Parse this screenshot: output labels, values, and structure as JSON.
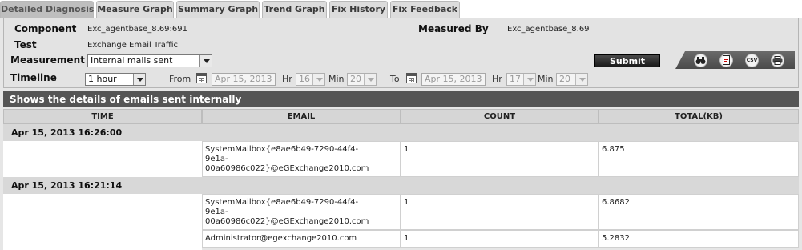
{
  "tabs": [
    {
      "label": "Detailed Diagnosis",
      "active": true
    },
    {
      "label": "Measure Graph"
    },
    {
      "label": "Summary Graph"
    },
    {
      "label": "Trend Graph"
    },
    {
      "label": "Fix History"
    },
    {
      "label": "Fix Feedback"
    }
  ],
  "header": {
    "component_label": "Component",
    "component_value": "Exc_agentbase_8.69:691",
    "test_label": "Test",
    "test_value": "Exchange Email Traffic",
    "measured_by_label": "Measured By",
    "measured_by_value": "Exc_agentbase_8.69",
    "measurement_label": "Measurement",
    "measurement_value": "Internal mails sent",
    "timeline_label": "Timeline",
    "timeline_value": "1 hour",
    "from_label": "From",
    "from_date": "Apr 15, 2013",
    "from_hr_label": "Hr",
    "from_hr": "16",
    "from_min_label": "Min",
    "from_min": "20",
    "to_label": "To",
    "to_date": "Apr 15, 2013",
    "to_hr_label": "Hr",
    "to_hr": "17",
    "to_min_label": "Min",
    "to_min": "20",
    "submit_label": "Submit"
  },
  "toolbar": {
    "icons": [
      "binoculars-icon",
      "pdf-icon",
      "csv-icon",
      "print-icon"
    ],
    "csv_text": "CSV"
  },
  "results": {
    "title": "Shows the details of emails sent internally",
    "columns": [
      "TIME",
      "EMAIL",
      "COUNT",
      "TOTAL(KB)"
    ],
    "groups": [
      {
        "time": "Apr 15, 2013 16:26:00",
        "rows": [
          {
            "email_l1": "SystemMailbox{e8ae6b49-7290-44f4-",
            "email_l2": "9e1a-",
            "email_l3": "00a60986c022}@eGExchange2010.com",
            "count": "1",
            "total": "6.875"
          }
        ]
      },
      {
        "time": "Apr 15, 2013 16:21:14",
        "rows": [
          {
            "email_l1": "SystemMailbox{e8ae6b49-7290-44f4-",
            "email_l2": "9e1a-",
            "email_l3": "00a60986c022}@eGExchange2010.com",
            "count": "1",
            "total": "6.8682"
          },
          {
            "email_l1": "Administrator@egexchange2010.com",
            "email_l2": "",
            "email_l3": "",
            "count": "1",
            "total": "5.2832"
          }
        ]
      }
    ]
  }
}
